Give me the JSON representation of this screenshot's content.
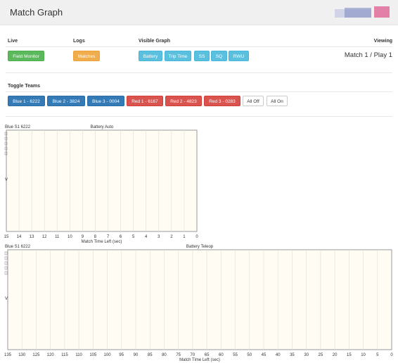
{
  "header": {
    "title": "Match Graph"
  },
  "sections": {
    "live": "Live",
    "logs": "Logs",
    "visible_graph": "Visible Graph",
    "viewing": "Viewing",
    "toggle_teams": "Toggle Teams"
  },
  "buttons": {
    "field_monitor": "Field Monitor",
    "matches": "Matches",
    "graph": [
      "Battery",
      "Trip Time",
      "SS",
      "SQ",
      "RWU"
    ],
    "teams": [
      {
        "label": "Blue 1 - 6222",
        "color": "#337ab7"
      },
      {
        "label": "Blue 2 - 3824",
        "color": "#337ab7"
      },
      {
        "label": "Blue 3 - 0004",
        "color": "#337ab7"
      },
      {
        "label": "Red 1 - 6167",
        "color": "#d9534f"
      },
      {
        "label": "Red 2 - 4823",
        "color": "#d9534f"
      },
      {
        "label": "Red 3 - 0283",
        "color": "#d9534f"
      }
    ],
    "all_off": "All Off",
    "all_on": "All On"
  },
  "viewing": "Match 1 / Play 1",
  "chart_data": [
    {
      "type": "line",
      "title": "Battery Auto",
      "legend": "Blue S1 6222",
      "xlabel": "Match Time Left (sec)",
      "ylabel": "V",
      "x_ticks": [
        15,
        14,
        13,
        12,
        11,
        10,
        9,
        8,
        7,
        6,
        5,
        4,
        3,
        2,
        1,
        0
      ],
      "xlim": [
        15,
        0
      ],
      "grid": true,
      "series": []
    },
    {
      "type": "line",
      "title": "Battery Teleop",
      "legend": "Blue S1 6222",
      "xlabel": "Match Time Left (sec)",
      "ylabel": "V",
      "x_ticks": [
        135,
        130,
        125,
        120,
        115,
        110,
        105,
        100,
        95,
        90,
        85,
        80,
        75,
        70,
        65,
        60,
        55,
        50,
        45,
        40,
        35,
        30,
        25,
        20,
        15,
        10,
        5,
        0
      ],
      "xlim": [
        135,
        0
      ],
      "grid": true,
      "series": []
    }
  ],
  "colors": {
    "plot_bg": "#fffdf3",
    "gridline": "#dcdcdc",
    "blue": "#337ab7",
    "red": "#d9534f",
    "green": "#5cb85c",
    "orange": "#f0ad4e",
    "cyan": "#5bc0de"
  }
}
